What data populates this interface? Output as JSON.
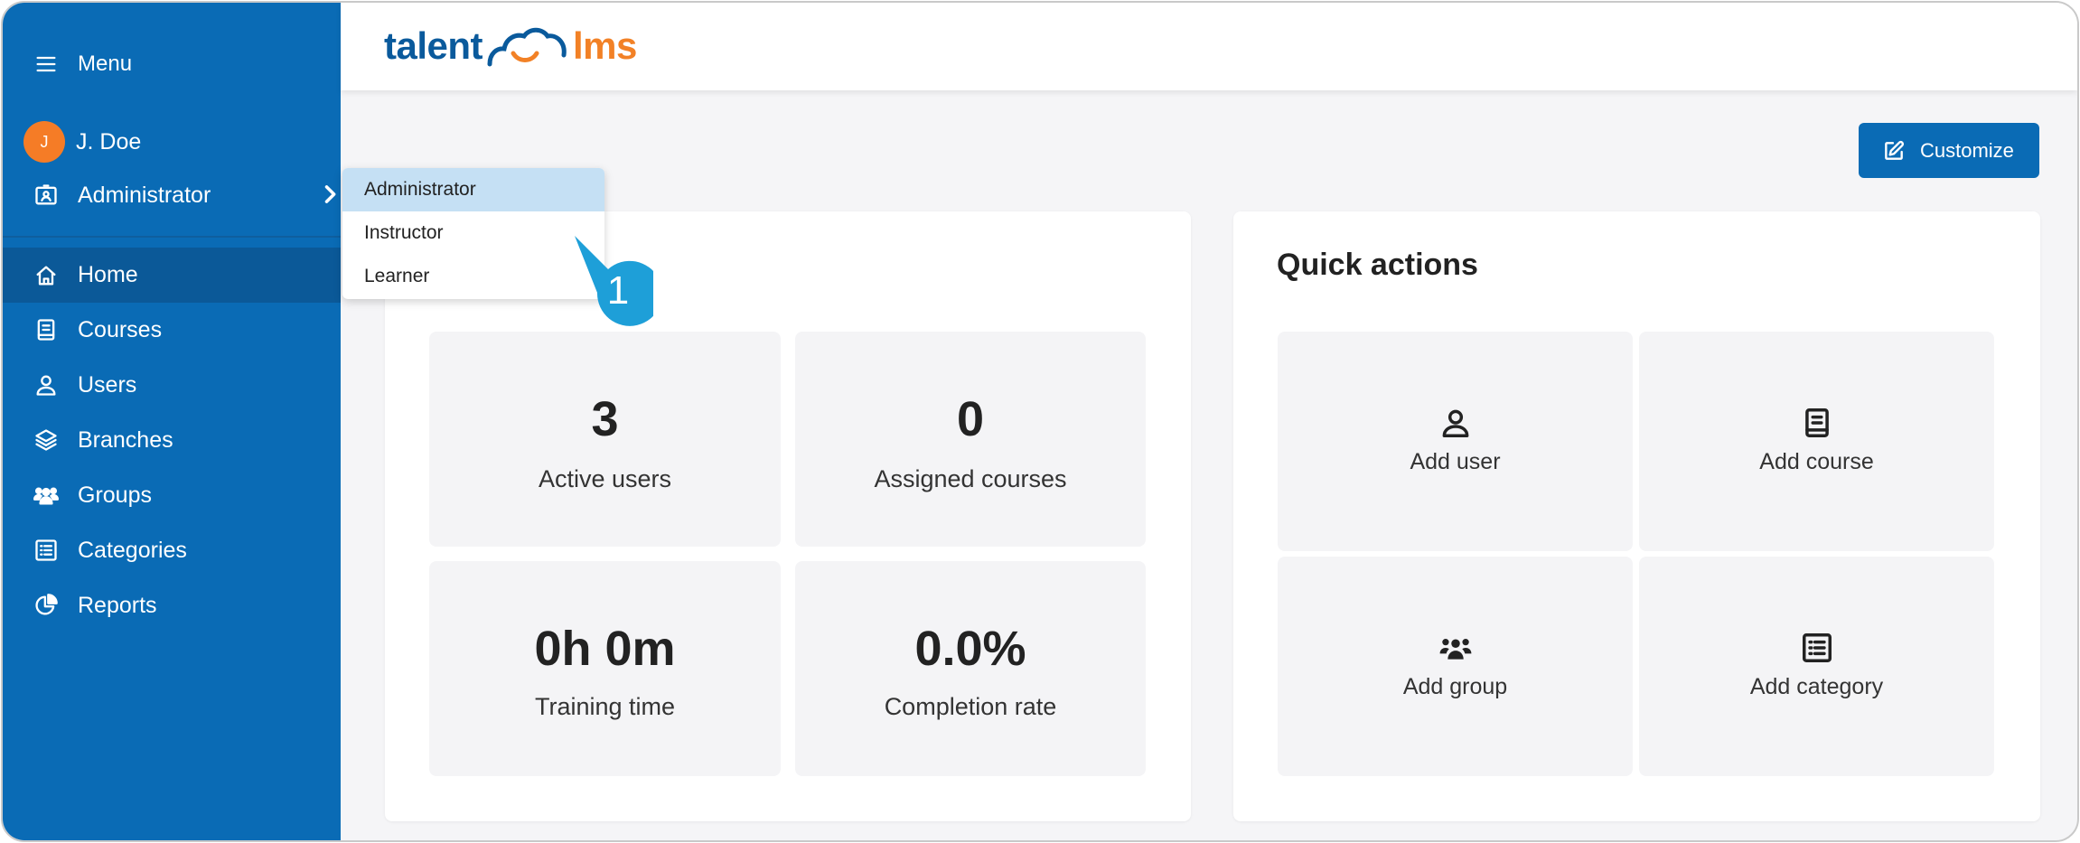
{
  "sidebar": {
    "menu_label": "Menu",
    "user_initial": "J",
    "user_name": "J. Doe",
    "role_label": "Administrator",
    "nav": {
      "home": "Home",
      "courses": "Courses",
      "users": "Users",
      "branches": "Branches",
      "groups": "Groups",
      "categories": "Categories",
      "reports": "Reports"
    }
  },
  "header": {
    "logo_left": "talent",
    "logo_right": "lms"
  },
  "toolbar": {
    "customize_label": "Customize"
  },
  "role_dropdown": {
    "options": [
      "Administrator",
      "Instructor",
      "Learner"
    ],
    "selected": "Administrator"
  },
  "callout": {
    "number": "1"
  },
  "stats": {
    "active_users": {
      "value": "3",
      "label": "Active users"
    },
    "assigned_courses": {
      "value": "0",
      "label": "Assigned courses"
    },
    "training_time": {
      "value": "0h 0m",
      "label": "Training time"
    },
    "completion_rate": {
      "value": "0.0%",
      "label": "Completion rate"
    }
  },
  "quick_actions": {
    "title": "Quick actions",
    "add_user": "Add user",
    "add_course": "Add course",
    "add_group": "Add group",
    "add_category": "Add category"
  },
  "colors": {
    "sidebar": "#0a6bb5",
    "sidebar_active": "#0b5998",
    "accent_orange": "#f57c26",
    "dropdown_selected": "#c5e0f4",
    "callout": "#1e9fd8"
  }
}
